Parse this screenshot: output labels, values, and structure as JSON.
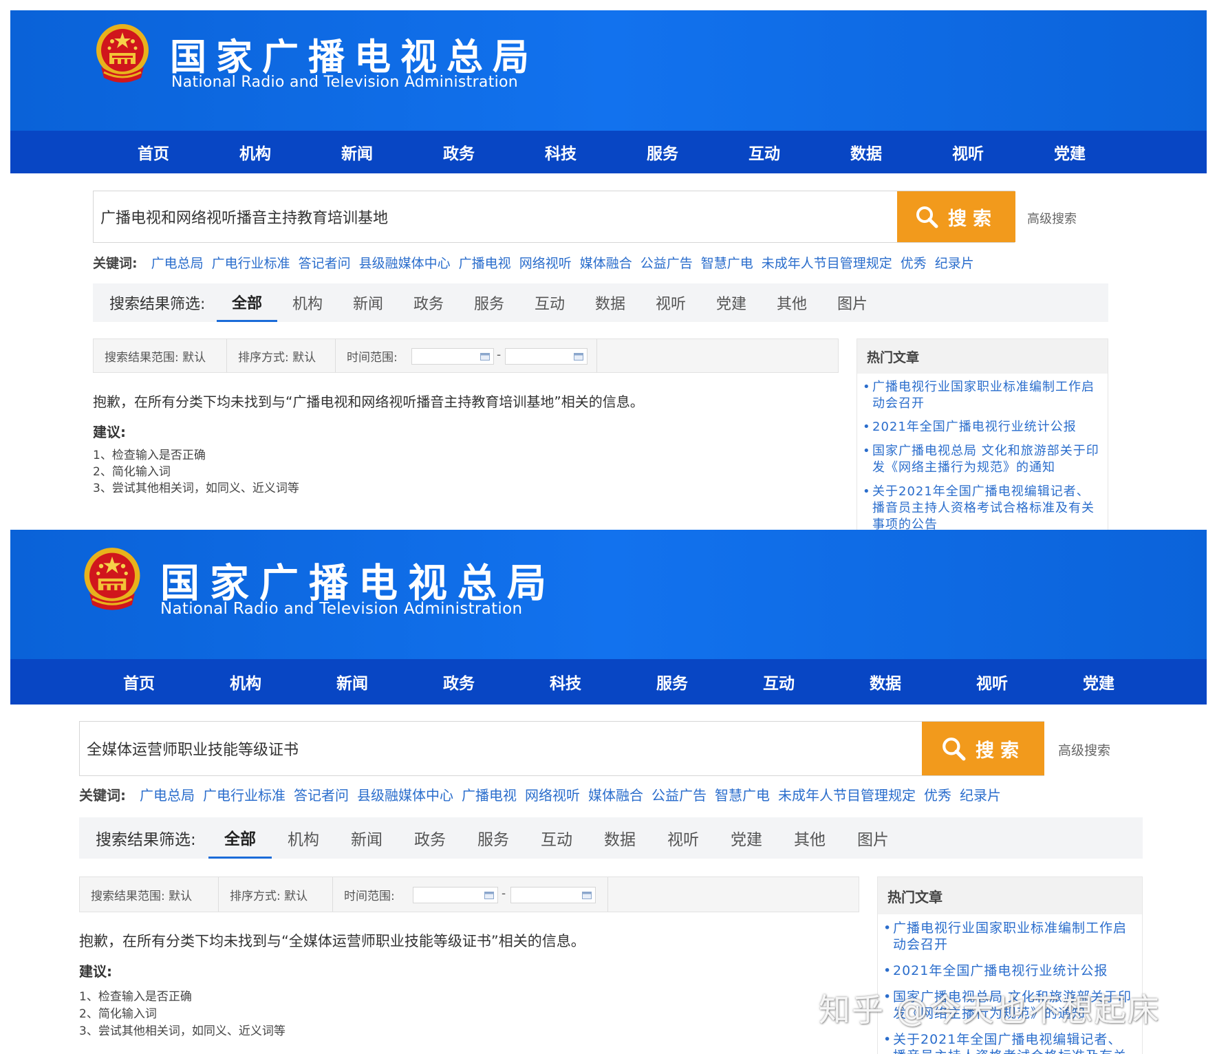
{
  "site": {
    "title": "国家广播电视总局",
    "subtitle": "National Radio and Television Administration",
    "brand_blue": "#1272ee",
    "nav_blue": "#0846c4",
    "accent_orange": "#f29a1c",
    "link_blue": "#2a6dcc"
  },
  "nav": [
    "首页",
    "机构",
    "新闻",
    "政务",
    "科技",
    "服务",
    "互动",
    "数据",
    "视听",
    "党建"
  ],
  "search": {
    "button_label": "搜索",
    "advanced_label": "高级搜索"
  },
  "keywords": {
    "label": "关键词:",
    "items": [
      "广电总局",
      "广电行业标准",
      "答记者问",
      "县级融媒体中心",
      "广播电视",
      "网络视听",
      "媒体融合",
      "公益广告",
      "智慧广电",
      "未成年人节目管理规定",
      "优秀",
      "纪录片"
    ]
  },
  "filter": {
    "label": "搜索结果筛选:",
    "tabs": [
      "全部",
      "机构",
      "新闻",
      "政务",
      "服务",
      "互动",
      "数据",
      "视听",
      "党建",
      "其他",
      "图片"
    ],
    "active_tab": "全部"
  },
  "options": {
    "scope": "搜索结果范围: 默认",
    "sort": "排序方式: 默认",
    "time": "时间范围:",
    "date_separator": "-"
  },
  "suggestions": {
    "title": "建议:",
    "items": [
      "1、检查输入是否正确",
      "2、简化输入词",
      "3、尝试其他相关词，如同义、近义词等"
    ]
  },
  "sidebar": {
    "title": "热门文章",
    "articles": [
      "广播电视行业国家职业标准编制工作启动会召开",
      "2021年全国广播电视行业统计公报",
      "国家广播电视总局 文化和旅游部关于印发《网络主播行为规范》的通知",
      "关于2021年全国广播电视编辑记者、播音员主持人资格考试合格标准及有关事项的公告"
    ]
  },
  "screens": [
    {
      "query": "广播电视和网络视听播音主持教育培训基地",
      "message": "抱歉，在所有分类下均未找到与“广播电视和网络视听播音主持教育培训基地”相关的信息。"
    },
    {
      "query": "全媒体运营师职业技能等级证书",
      "message": "抱歉，在所有分类下均未找到与“全媒体运营师职业技能等级证书”相关的信息。"
    }
  ],
  "watermark": "知乎 @今天也不想起床"
}
